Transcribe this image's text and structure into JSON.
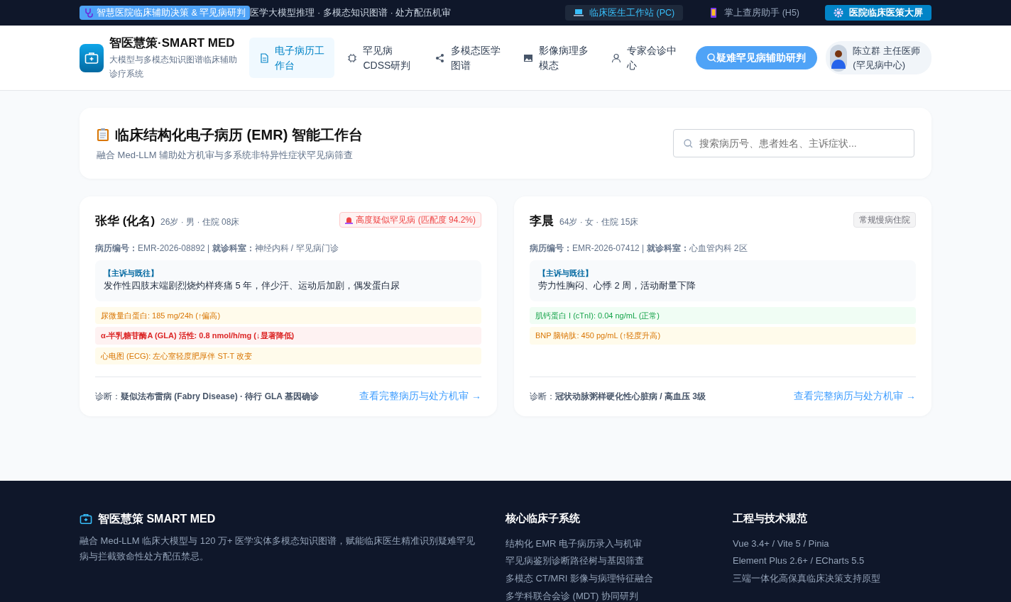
{
  "top_bar": {
    "tag": "智慧医院临床辅助决策 & 罕见病研判",
    "tagline": "医学大模型推理 · 多模态知识图谱 · 处方配伍机审",
    "links": [
      {
        "label": "临床医生工作站 (PC)",
        "kind": "active"
      },
      {
        "label": "掌上查房助手 (H5)",
        "kind": "plain"
      },
      {
        "label": "医院临床医策大屏",
        "kind": "primary"
      }
    ]
  },
  "header": {
    "brand": "智医慧策·SMART MED",
    "subtitle": "大模型与多模态知识图谱临床辅助诊疗系统",
    "nav": [
      {
        "label": "电子病历工作台",
        "selected": true
      },
      {
        "label": "罕见病CDSS研判",
        "selected": false
      },
      {
        "label": "多模态医学图谱",
        "selected": false
      },
      {
        "label": "影像病理多模态",
        "selected": false
      },
      {
        "label": "专家会诊中心",
        "selected": false
      }
    ],
    "action_button": "疑难罕见病辅助研判",
    "user": {
      "name": "陈立群 主任医师",
      "dept": "(罕见病中心)"
    }
  },
  "hero": {
    "title": "临床结构化电子病历 (EMR) 智能工作台",
    "subtitle": "融合 Med-LLM 辅助处方机审与多系统非特异性症状罕见病筛查",
    "search": {
      "placeholder": "搜索病历号、患者姓名、主诉症状..."
    }
  },
  "patients": [
    {
      "name": "张华 (化名)",
      "meta": "26岁 · 男 · 住院 08床",
      "badge": "高度疑似罕见病 (匹配度 94.2%)",
      "kind": "alert",
      "record": "**病历编号：**EMR-2026-08892 | **就诊科室：**神经内科 / 罕见病门诊",
      "complaint_label": "【主诉与既往】",
      "complaint": "发作性四肢末端剧烈烧灼样疼痛 5 年，伴少汗、运动后加剧，偶发蛋白尿",
      "labs": [
        {
          "text": "尿微量白蛋白: 185 mg/24h (↑偏高)",
          "kind": "warning"
        },
        {
          "text": "α-半乳糖苷酶A (GLA) 活性: 0.8 nmol/h/mg (↓显著降低)",
          "kind": "danger"
        },
        {
          "text": "心电图 (ECG): 左心室轻度肥厚伴 ST-T 改变",
          "kind": "warning"
        }
      ],
      "diagnosis": "诊断：**疑似法布雷病 (Fabry Disease) · 待行 GLA 基因确诊**",
      "link": "查看完整病历与处方机审 →"
    },
    {
      "name": "李晨",
      "meta": "64岁 · 女 · 住院 15床",
      "badge": "常规慢病住院",
      "kind": "neutral",
      "record": "**病历编号：**EMR-2026-07412 | **就诊科室：**心血管内科 2区",
      "complaint_label": "【主诉与既往】",
      "complaint": "劳力性胸闷、心悸 2 周，活动耐量下降",
      "labs": [
        {
          "text": "肌钙蛋白 I (cTnI): 0.04 ng/mL (正常)",
          "kind": "normal"
        },
        {
          "text": "BNP 脑钠肽: 450 pg/mL (↑轻度升高)",
          "kind": "warning"
        }
      ],
      "diagnosis": "诊断：**冠状动脉粥样硬化性心脏病 / 高血压 3级**",
      "link": "查看完整病历与处方机审 →"
    }
  ],
  "footer": {
    "brand": "智医慧策 SMART MED",
    "description": "融合 Med-LLM 临床大模型与 120 万+ 医学实体多模态知识图谱，赋能临床医生精准识别疑难罕见病与拦截致命性处方配伍禁忌。",
    "columns": [
      {
        "title": "核心临床子系统",
        "items": [
          "结构化 EMR 电子病历录入与机审",
          "罕见病鉴别诊断路径树与基因筛查",
          "多模态 CT/MRI 影像与病理特征融合",
          "多学科联合会诊 (MDT) 协同研判"
        ]
      },
      {
        "title": "工程与技术规范",
        "items": [
          "Vue 3.4+ / Vite 5 / Pinia",
          "Element Plus 2.6+ / ECharts 5.5",
          "三端一体化高保真临床决策支持原型"
        ]
      }
    ]
  }
}
